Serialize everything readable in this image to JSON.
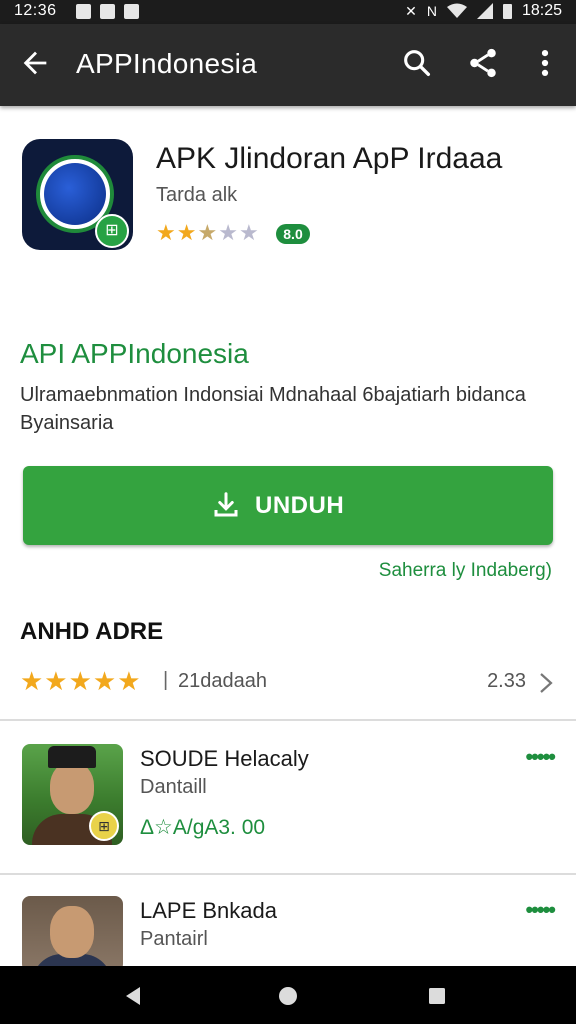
{
  "status_bar": {
    "time_left": "12:36",
    "time_right": "18:25",
    "network": "N"
  },
  "toolbar": {
    "title": "APPIndonesia"
  },
  "app": {
    "name": "APK Jlindoran ApP Irdaaa",
    "developer": "Tarda alk",
    "rating_badge": "8.0",
    "icon_badge": "⊞",
    "stars": [
      "★",
      "★",
      "★",
      "★",
      "★"
    ]
  },
  "section": {
    "heading": "API APPIndonesia",
    "description": "Ulramaebnmation Indonsiai Mdnahaal 6bajatiarh bidanca Byainsaria"
  },
  "install": {
    "label": "UNDUH"
  },
  "secondary_link": "Saherra ly Indaberg)",
  "reviews": {
    "heading": "ANHD ADRE",
    "stars": "★★★★★",
    "separator": "|",
    "count": "21dadaah",
    "score": "2.33"
  },
  "list": [
    {
      "title": "SOUDE Helacaly",
      "subtitle": "Dantaill",
      "price": "Δ☆A/gA3. 00",
      "menu": "•••••"
    },
    {
      "title": "LAPE Bnkada",
      "subtitle": "Pantairl",
      "menu": "•••••"
    }
  ],
  "thumb_badge": "⊞"
}
